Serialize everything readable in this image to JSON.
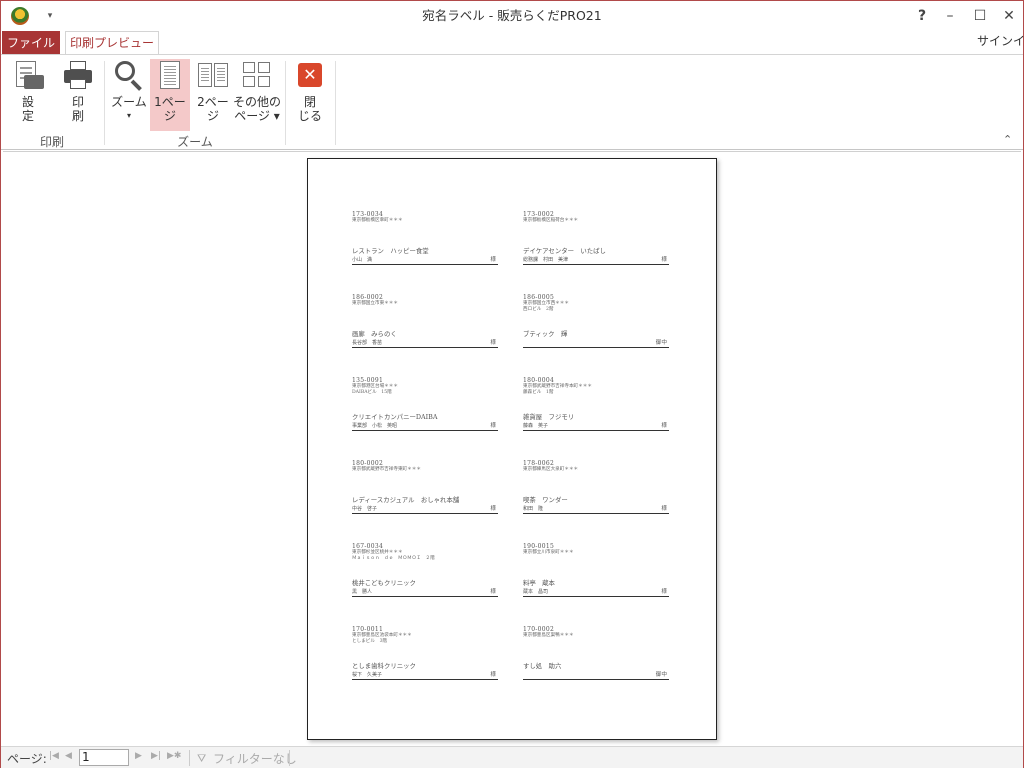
{
  "window": {
    "title": "宛名ラベル - 販売らくだPRO21",
    "help": "?",
    "minimize": "–",
    "maximize": "☐",
    "close": "✕",
    "qat_arrow": "▾"
  },
  "tabs": {
    "file": "ファイル",
    "print_preview": "印刷プレビュー",
    "signin": "サインイン"
  },
  "ribbon": {
    "groups": {
      "print": "印刷",
      "zoom": "ズーム"
    },
    "buttons": {
      "settings": [
        "設",
        "定"
      ],
      "print": [
        "印",
        "刷"
      ],
      "zoom": [
        "ズーム",
        "▾"
      ],
      "one_page": [
        "1ペー",
        "ジ"
      ],
      "two_pages": [
        "2ペー",
        "ジ"
      ],
      "more_pages": [
        "その他の",
        "ページ ▾"
      ],
      "close": [
        "閉",
        "じる"
      ]
    },
    "collapse": "⌃"
  },
  "labels": [
    {
      "zip": "173-0034",
      "addr": [
        "東京都板橋区幸町＊＊＊"
      ],
      "name1": "レストラン　ハッピー食堂",
      "name2": "小山　満",
      "hon": "様"
    },
    {
      "zip": "173-0002",
      "addr": [
        "東京都板橋区稲荷台＊＊＊"
      ],
      "name1": "デイケアセンター　いたばし",
      "name2": "総務課　村田　美津",
      "hon": "様"
    },
    {
      "zip": "186-0002",
      "addr": [
        "東京都国立市東＊＊＊"
      ],
      "name1": "画廊　みらのく",
      "name2": "長谷部　香苗",
      "hon": "様"
    },
    {
      "zip": "186-0005",
      "addr": [
        "東京都国立市西＊＊＊",
        "西ロビル　2階"
      ],
      "name1": "ブティック　輝",
      "name2": "",
      "hon": "御中"
    },
    {
      "zip": "135-0091",
      "addr": [
        "東京都港区台場＊＊＊",
        "DAIBAビル　15階"
      ],
      "name1": "クリエイトカンパニーDAIBA",
      "name2": "事業部　小松　英昭",
      "hon": "様"
    },
    {
      "zip": "180-0004",
      "addr": [
        "東京都武蔵野市吉祥寺本町＊＊＊",
        "藤森ビル　1階"
      ],
      "name1": "雑貨屋　フジモリ",
      "name2": "藤森　英子",
      "hon": "様"
    },
    {
      "zip": "180-0002",
      "addr": [
        "東京都武蔵野市吉祥寺東町＊＊＊"
      ],
      "name1": "レディースカジュアル　おしゃれ本舗",
      "name2": "中谷　啓子",
      "hon": "様"
    },
    {
      "zip": "178-0062",
      "addr": [
        "東京都練馬区大泉町＊＊＊"
      ],
      "name1": "喫茶　ワンダー",
      "name2": "和田　隆",
      "hon": "様"
    },
    {
      "zip": "167-0034",
      "addr": [
        "東京都杉並区桃井＊＊＊",
        "Ｍａｉｓｏｎ　ｄｅ　ＭＯＭＯＩ　２階"
      ],
      "name1": "桃井こどもクリニック",
      "name2": "黒　勝人",
      "hon": "様"
    },
    {
      "zip": "190-0015",
      "addr": [
        "東京都立川市泉町＊＊＊"
      ],
      "name1": "料亭　蔵本",
      "name2": "蔵本　昌司",
      "hon": "様"
    },
    {
      "zip": "170-0011",
      "addr": [
        "東京都豊島区池袋本町＊＊＊",
        "としまビル　3階"
      ],
      "name1": "としま歯科クリニック",
      "name2": "桜下　久美子",
      "hon": "様"
    },
    {
      "zip": "170-0002",
      "addr": [
        "東京都豊島区巣鴨＊＊＊"
      ],
      "name1": "すし処　助六",
      "name2": "",
      "hon": "御中"
    }
  ],
  "statusbar": {
    "page_label": "ページ:",
    "page_value": "1",
    "first": "|◀",
    "prev": "◀",
    "next": "▶",
    "last": "▶|",
    "new": "▶✱",
    "filter_icon": "funnel-icon",
    "filter_text": "フィルターなし"
  }
}
